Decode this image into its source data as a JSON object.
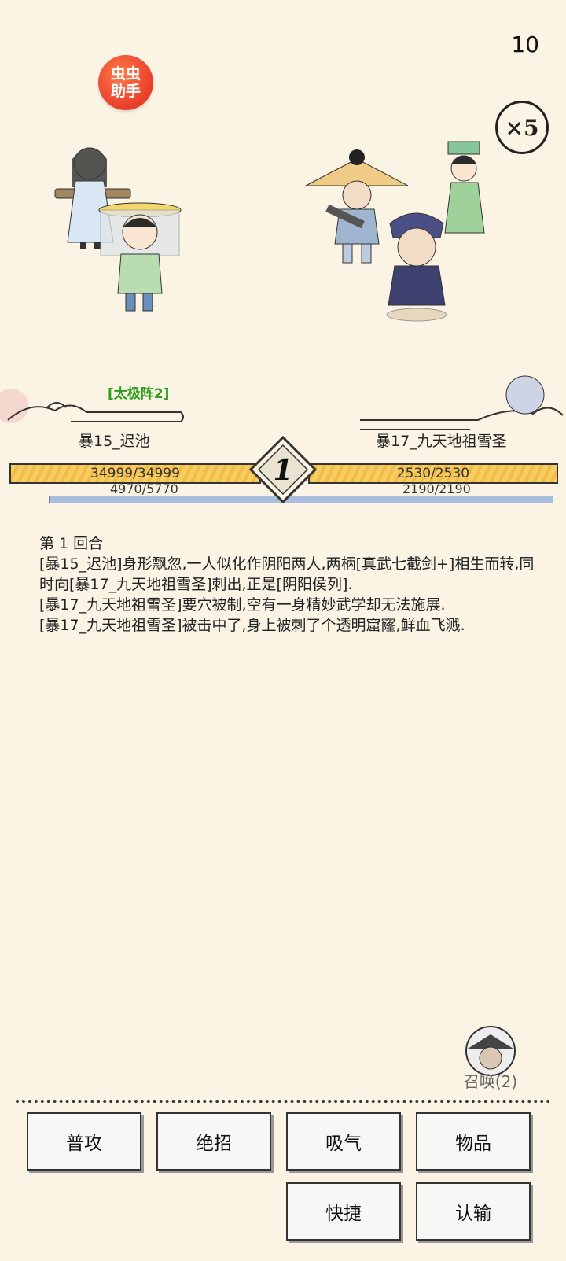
{
  "turn_counter": "10",
  "helper_badge": {
    "line1": "虫虫",
    "line2": "助手"
  },
  "speed_badge": "×5",
  "battle": {
    "formation_tag": "[太极阵2]",
    "round_number": "1",
    "left": {
      "name": "暴15_迟池",
      "hp_text": "34999/34999",
      "mp_text": "4970/5770",
      "hp_fraction": 1.0,
      "mp_fraction": 0.861
    },
    "right": {
      "name": "暴17_九天地祖雪圣",
      "hp_text": "2530/2530",
      "mp_text": "2190/2190",
      "hp_fraction": 1.0,
      "mp_fraction": 1.0
    }
  },
  "log": {
    "title": "第 1 回合",
    "lines": [
      "[暴15_迟池]身形飘忽,一人似化作阴阳两人,两柄[真武七截剑+]相生而转,同时向[暴17_九天地祖雪圣]刺出,正是[阴阳侯列].",
      "[暴17_九天地祖雪圣]要穴被制,空有一身精妙武学却无法施展.",
      "[暴17_九天地祖雪圣]被击中了,身上被刺了个透明窟窿,鲜血飞溅."
    ]
  },
  "summon": {
    "label": "召唤(2)"
  },
  "actions": {
    "attack": "普攻",
    "ultimate": "绝招",
    "breathe": "吸气",
    "items": "物品",
    "quick": "快捷",
    "surrender": "认输"
  },
  "colors": {
    "background": "#fbf4e4",
    "hp_fill": "#f3bc45",
    "mp_fill": "#a8bde0",
    "formation": "#2e9e1f"
  }
}
